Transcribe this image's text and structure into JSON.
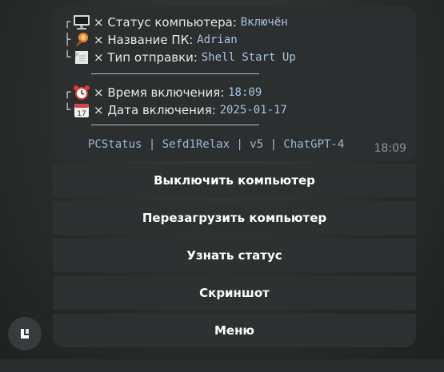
{
  "message": {
    "rows1": [
      {
        "tree": "┌",
        "icon": "monitor-icon",
        "label": "× Статус компьютера:",
        "value": "Включён"
      },
      {
        "tree": "├",
        "icon": "torch-icon",
        "label": "× Название ПК:",
        "value": "Adrian"
      },
      {
        "tree": "└",
        "icon": "page-icon",
        "label": "× Тип отправки:",
        "value": "Shell Start Up"
      }
    ],
    "rows2": [
      {
        "tree": "┌",
        "icon": "alarm-clock-icon",
        "label": "× Время включения:",
        "value": "18:09"
      },
      {
        "tree": "└",
        "icon": "calendar-icon",
        "label": "× Дата включения:",
        "value": "2025-01-17"
      }
    ],
    "footer": "PCStatus | Sefd1Relax | v5 | ChatGPT-4",
    "time": "18:09"
  },
  "keyboard": {
    "buttons": [
      "Выключить компьютер",
      "Перезагрузить компьютер",
      "Узнать статус",
      "Скриншот",
      "Меню"
    ]
  },
  "colors": {
    "bubble": "#2b2f30",
    "button": "#2e3131",
    "mono_value": "#a9c3dd",
    "footer": "#9bb8d6"
  }
}
